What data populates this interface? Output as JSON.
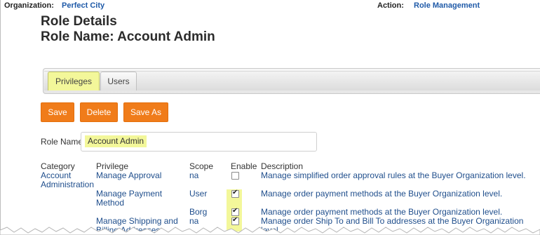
{
  "header": {
    "org_label": "Organization:",
    "org_value": "Perfect City",
    "action_label": "Action:",
    "action_value": "Role Management"
  },
  "page": {
    "title": "Role Details",
    "subtitle": "Role Name: Account Admin"
  },
  "tabs": [
    {
      "label": "Privileges",
      "active": true
    },
    {
      "label": "Users",
      "active": false
    }
  ],
  "buttons": {
    "save": "Save",
    "delete": "Delete",
    "save_as": "Save As"
  },
  "role_name": {
    "label": "Role Name",
    "value": "Account Admin"
  },
  "table": {
    "headers": {
      "category": "Category",
      "privilege": "Privilege",
      "scope": "Scope",
      "enable": "Enable",
      "description": "Description"
    },
    "category_value": "Account Administration",
    "rows": [
      {
        "privilege": "Manage Approval",
        "scope": "na",
        "enabled": false,
        "description": "Manage simplified order approval rules at the Buyer Organization level."
      },
      {
        "privilege": "Manage Payment Method",
        "scope": "User",
        "enabled": true,
        "description": "Manage order payment methods at the Buyer Organization level."
      },
      {
        "privilege": "",
        "scope": "Borg",
        "enabled": true,
        "description": "Manage order payment methods at the Buyer Organization level."
      },
      {
        "privilege": "Manage Shipping and Billing Addresses",
        "scope": "na",
        "enabled": true,
        "description": "Manage order Ship To and Bill To addresses at the Buyer Organization level."
      }
    ]
  },
  "colors": {
    "accent_orange": "#f07c1a",
    "highlight_yellow": "#f3f79a",
    "link_blue": "#1f5aa8"
  }
}
